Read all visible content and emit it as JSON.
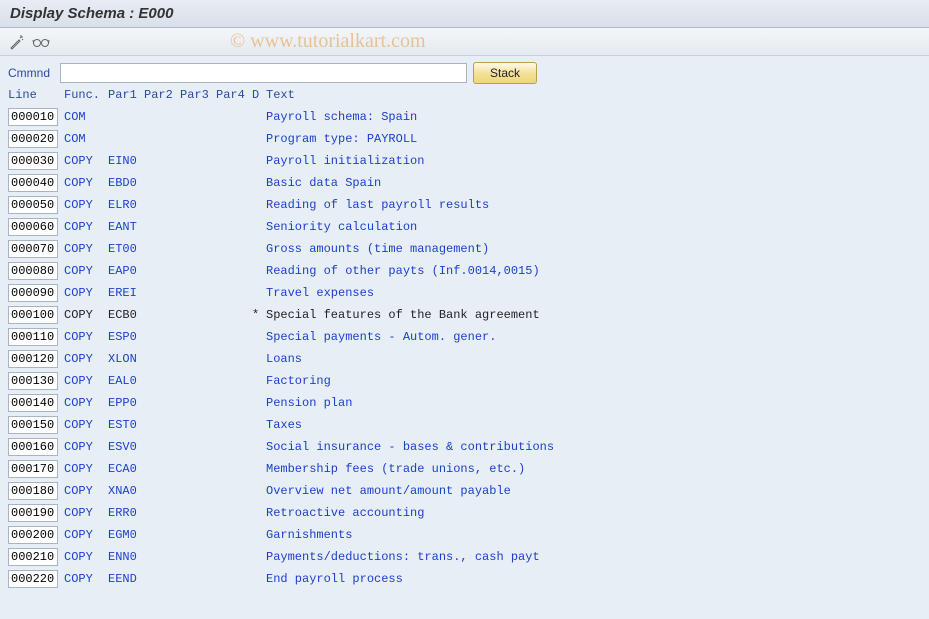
{
  "title": "Display Schema : E000",
  "watermark": "© www.tutorialkart.com",
  "command": {
    "label": "Cmmnd",
    "value": "",
    "stack_label": "Stack"
  },
  "headers": {
    "line": "Line",
    "func": "Func.",
    "par1": "Par1",
    "par2": "Par2",
    "par3": "Par3",
    "par4": "Par4",
    "d": "D",
    "text": "Text"
  },
  "rows": [
    {
      "line": "000010",
      "func": "COM",
      "par1": "",
      "d": "",
      "text": "Payroll schema: Spain",
      "plain": false
    },
    {
      "line": "000020",
      "func": "COM",
      "par1": "",
      "d": "",
      "text": "Program type: PAYROLL",
      "plain": false
    },
    {
      "line": "000030",
      "func": "COPY",
      "par1": "EIN0",
      "d": "",
      "text": "Payroll initialization",
      "plain": false
    },
    {
      "line": "000040",
      "func": "COPY",
      "par1": "EBD0",
      "d": "",
      "text": "Basic data Spain",
      "plain": false
    },
    {
      "line": "000050",
      "func": "COPY",
      "par1": "ELR0",
      "d": "",
      "text": "Reading of last payroll results",
      "plain": false
    },
    {
      "line": "000060",
      "func": "COPY",
      "par1": "EANT",
      "d": "",
      "text": "Seniority calculation",
      "plain": false
    },
    {
      "line": "000070",
      "func": "COPY",
      "par1": "ET00",
      "d": "",
      "text": "Gross amounts (time management)",
      "plain": false
    },
    {
      "line": "000080",
      "func": "COPY",
      "par1": "EAP0",
      "d": "",
      "text": "Reading of other payts (Inf.0014,0015)",
      "plain": false
    },
    {
      "line": "000090",
      "func": "COPY",
      "par1": "EREI",
      "d": "",
      "text": "Travel expenses",
      "plain": false
    },
    {
      "line": "000100",
      "func": "COPY",
      "par1": "ECB0",
      "d": "*",
      "text": "Special features of the Bank agreement",
      "plain": true
    },
    {
      "line": "000110",
      "func": "COPY",
      "par1": "ESP0",
      "d": "",
      "text": "Special payments - Autom. gener.",
      "plain": false
    },
    {
      "line": "000120",
      "func": "COPY",
      "par1": "XLON",
      "d": "",
      "text": "Loans",
      "plain": false
    },
    {
      "line": "000130",
      "func": "COPY",
      "par1": "EAL0",
      "d": "",
      "text": "Factoring",
      "plain": false
    },
    {
      "line": "000140",
      "func": "COPY",
      "par1": "EPP0",
      "d": "",
      "text": "Pension plan",
      "plain": false
    },
    {
      "line": "000150",
      "func": "COPY",
      "par1": "EST0",
      "d": "",
      "text": "Taxes",
      "plain": false
    },
    {
      "line": "000160",
      "func": "COPY",
      "par1": "ESV0",
      "d": "",
      "text": "Social insurance - bases & contributions",
      "plain": false
    },
    {
      "line": "000170",
      "func": "COPY",
      "par1": "ECA0",
      "d": "",
      "text": "Membership fees (trade unions, etc.)",
      "plain": false
    },
    {
      "line": "000180",
      "func": "COPY",
      "par1": "XNA0",
      "d": "",
      "text": "Overview net amount/amount payable",
      "plain": false
    },
    {
      "line": "000190",
      "func": "COPY",
      "par1": "ERR0",
      "d": "",
      "text": "Retroactive accounting",
      "plain": false
    },
    {
      "line": "000200",
      "func": "COPY",
      "par1": "EGM0",
      "d": "",
      "text": "Garnishments",
      "plain": false
    },
    {
      "line": "000210",
      "func": "COPY",
      "par1": "ENN0",
      "d": "",
      "text": "Payments/deductions: trans., cash payt",
      "plain": false
    },
    {
      "line": "000220",
      "func": "COPY",
      "par1": "EEND",
      "d": "",
      "text": "End payroll process",
      "plain": false
    }
  ]
}
